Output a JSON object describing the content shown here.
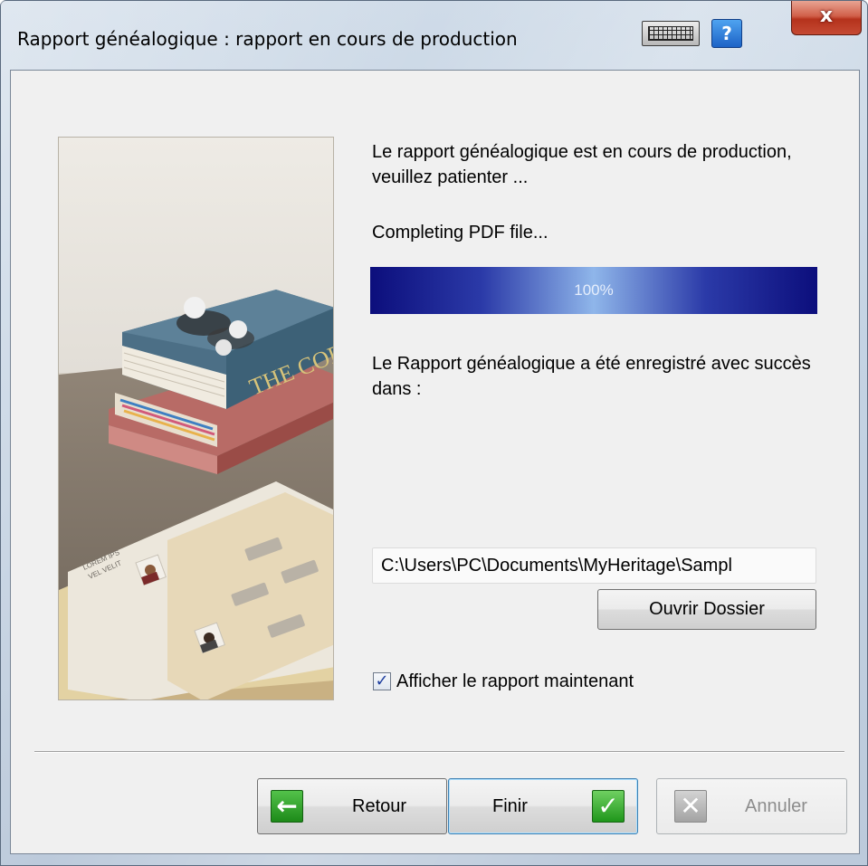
{
  "window": {
    "title": "Rapport généalogique : rapport en cours de production",
    "help_label": "?",
    "close_label": "x"
  },
  "content": {
    "message": "Le rapport généalogique est en cours de production, veuillez patienter ...",
    "status": "Completing PDF file...",
    "progress": {
      "value": 100,
      "label": "100%"
    },
    "saved_message": "Le Rapport généalogique a été enregistré avec succès dans :",
    "file_path": "C:\\Users\\PC\\Documents\\MyHeritage\\Sampl",
    "open_folder_label": "Ouvrir Dossier",
    "show_report_checkbox": {
      "label": "Afficher le rapport maintenant",
      "checked": true
    }
  },
  "illustration": {
    "book_spine_text": "THE COPP",
    "sheet_text_1": "LOREM IPS",
    "sheet_text_2": "VEL VELIT"
  },
  "footer": {
    "back_label": "Retour",
    "finish_label": "Finir",
    "cancel_label": "Annuler"
  },
  "colors": {
    "progress_dark": "#0c0e7c",
    "progress_light": "#8fb6ea",
    "accent_green": "#1f961b"
  }
}
